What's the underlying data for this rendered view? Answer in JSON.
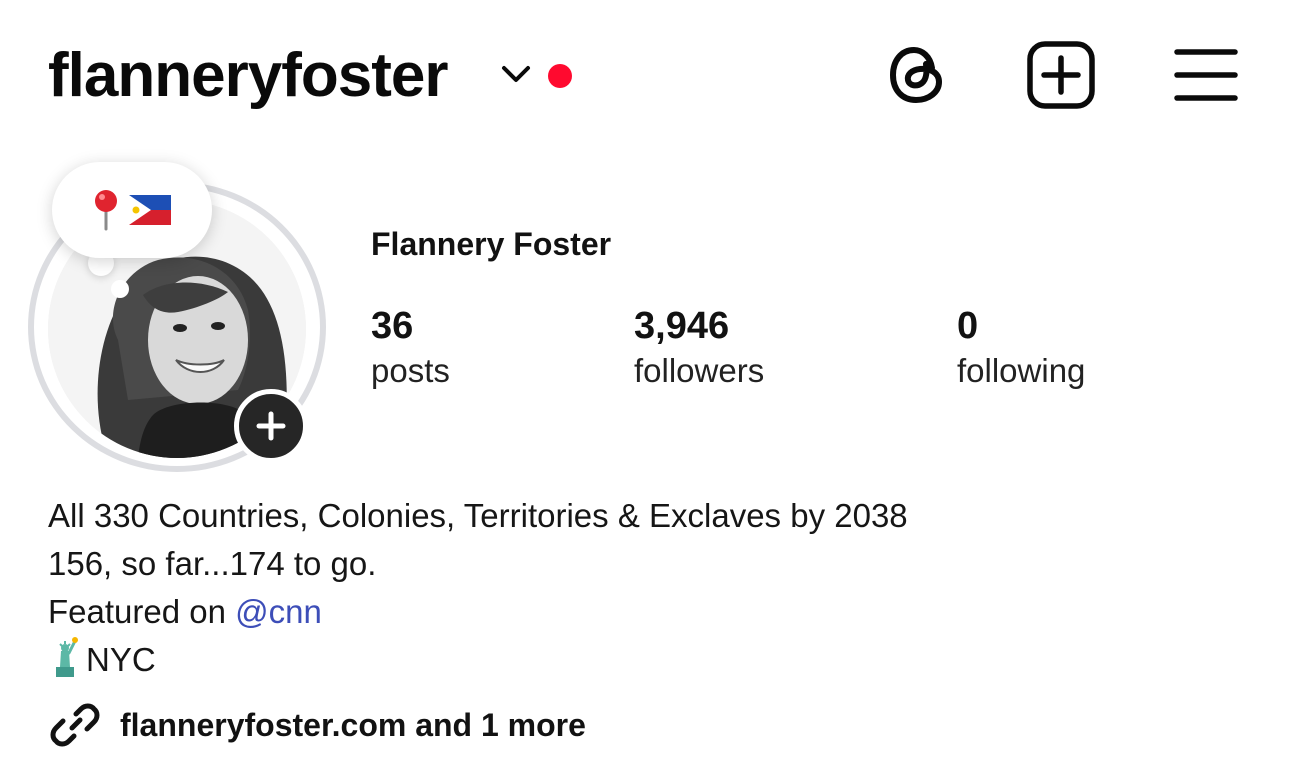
{
  "header": {
    "username": "flanneryfoster",
    "icons": [
      "chevron-down-icon",
      "notification-dot",
      "threads-icon",
      "new-post-icon",
      "menu-icon"
    ],
    "notification_color": "#ff0a2f"
  },
  "note": {
    "emoji_pin": "📍",
    "emoji_flag": "🇵🇭"
  },
  "profile": {
    "display_name": "Flannery Foster",
    "stats": [
      {
        "value": "36",
        "label": "posts"
      },
      {
        "value": "3,946",
        "label": "followers"
      },
      {
        "value": "0",
        "label": "following"
      }
    ]
  },
  "bio": {
    "line1": "All 330 Countries, Colonies, Territories & Exclaves by 2038",
    "line2": "156, so far...174 to go.",
    "line3_prefix": "Featured on ",
    "line3_mention": "@cnn",
    "line4": "NYC",
    "mention_color": "#3d4eb8"
  },
  "links": {
    "text": "flanneryfoster.com and 1 more"
  }
}
